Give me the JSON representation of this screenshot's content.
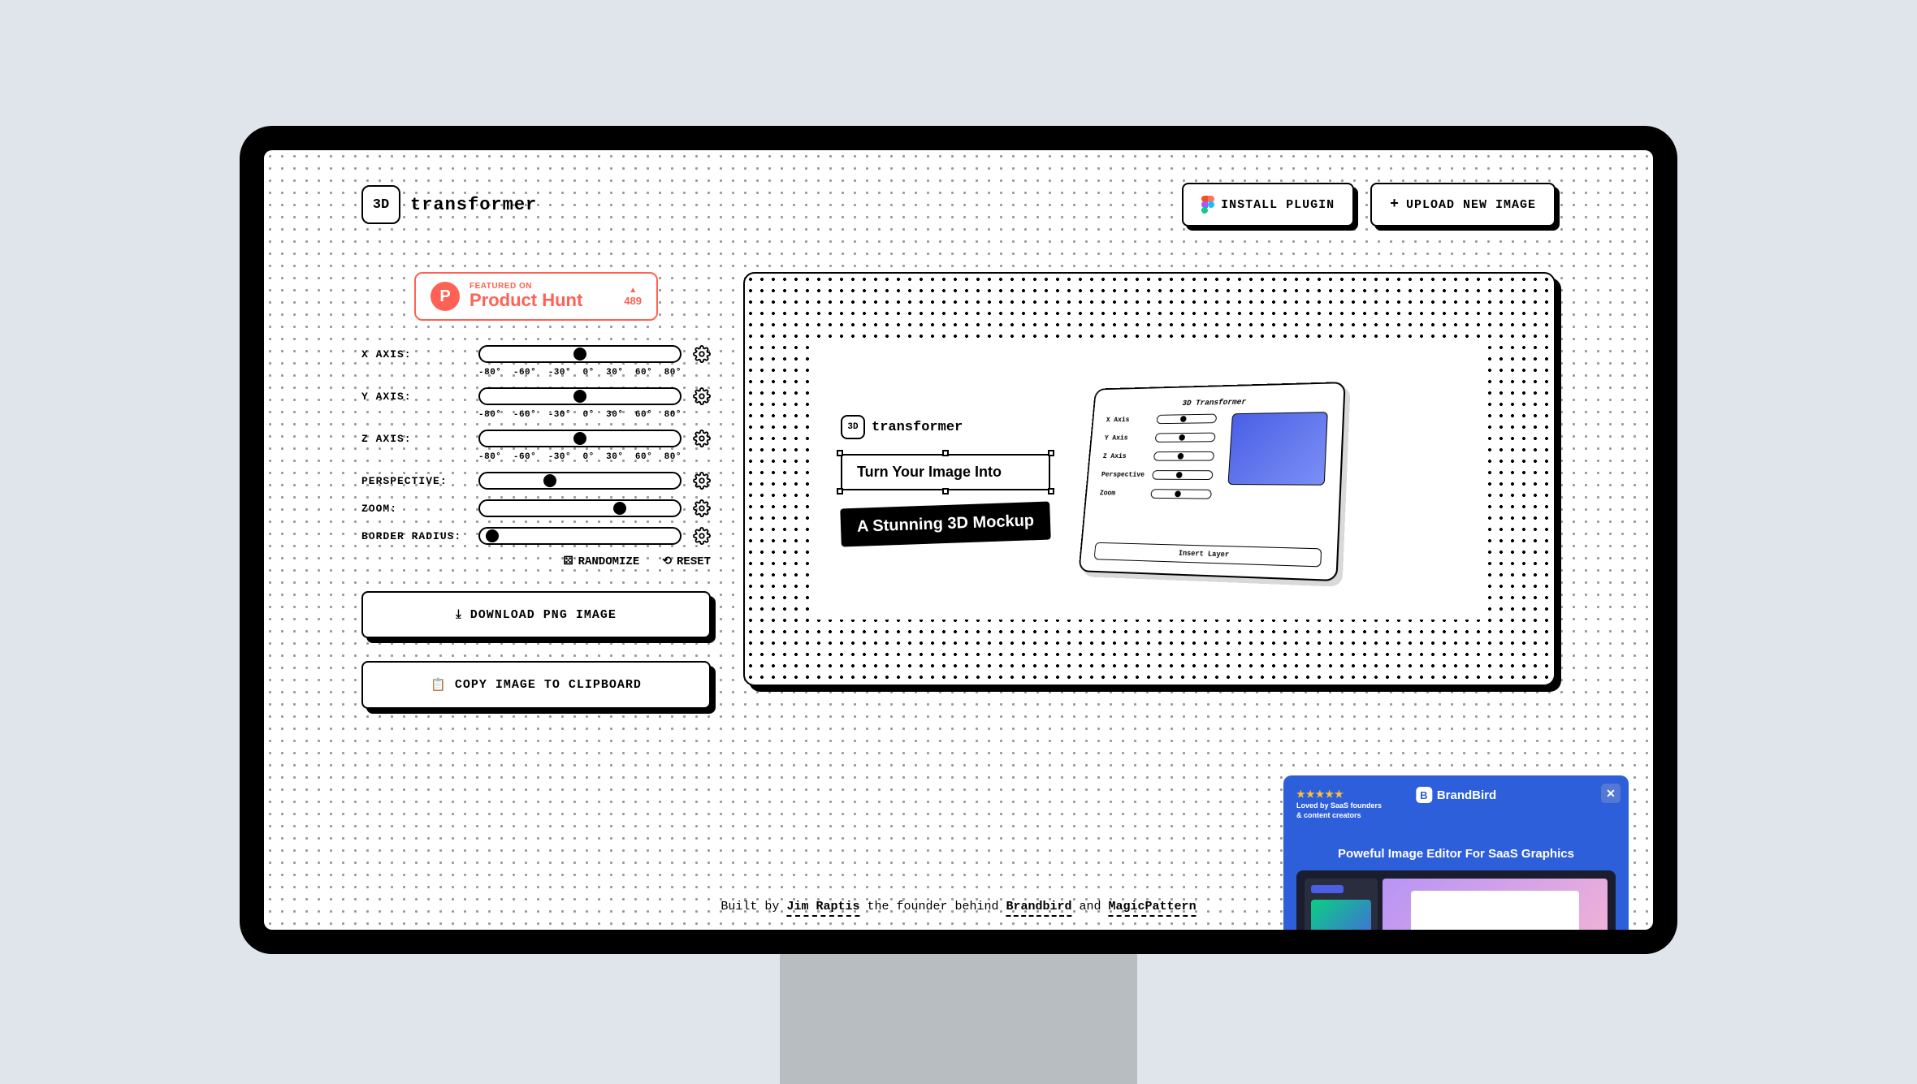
{
  "logo": {
    "mark": "3D",
    "text": "transformer"
  },
  "header": {
    "install": "INSTALL PLUGIN",
    "upload": "UPLOAD NEW IMAGE"
  },
  "productHunt": {
    "sub": "FEATURED ON",
    "main": "Product Hunt",
    "upvotes": "489"
  },
  "sliders": {
    "x": {
      "label": "X AXIS:",
      "pos": 50,
      "ticks": [
        "-80°",
        "-60°",
        "-30°",
        "0°",
        "30°",
        "60°",
        "80°"
      ]
    },
    "y": {
      "label": "Y AXIS:",
      "pos": 50,
      "ticks": [
        "-80°",
        "-60°",
        "-30°",
        "0°",
        "30°",
        "60°",
        "80°"
      ]
    },
    "z": {
      "label": "Z AXIS:",
      "pos": 50,
      "ticks": [
        "-80°",
        "-60°",
        "-30°",
        "0°",
        "30°",
        "60°",
        "80°"
      ]
    },
    "persp": {
      "label": "PERSPECTIVE:",
      "pos": 35
    },
    "zoom": {
      "label": "ZOOM:",
      "pos": 70
    },
    "radius": {
      "label": "BORDER RADIUS:",
      "pos": 6
    }
  },
  "actions": {
    "randomize": "RANDOMIZE",
    "reset": "RESET",
    "download": "DOWNLOAD PNG IMAGE",
    "copy": "COPY IMAGE TO CLIPBOARD"
  },
  "preview": {
    "logoMark": "3D",
    "logoText": "transformer",
    "line1": "Turn Your Image Into",
    "line2": "A Stunning 3D Mockup",
    "mockTitle": "3D Transformer",
    "mockLabels": [
      "X Axis",
      "Y Axis",
      "Z Axis",
      "Perspective",
      "Zoom"
    ],
    "mockBtn": "Insert Layer"
  },
  "footer": {
    "t1": "Built by ",
    "author": "Jim Raptis",
    "t2": " the founder behind ",
    "brand1": "Brandbird",
    "t3": " and ",
    "brand2": "MagicPattern"
  },
  "promo": {
    "stars": "★★★★★",
    "byline1": "Loved by SaaS founders",
    "byline2": "& content creators",
    "brand": "BrandBird",
    "headline": "Poweful Image Editor For SaaS Graphics"
  }
}
